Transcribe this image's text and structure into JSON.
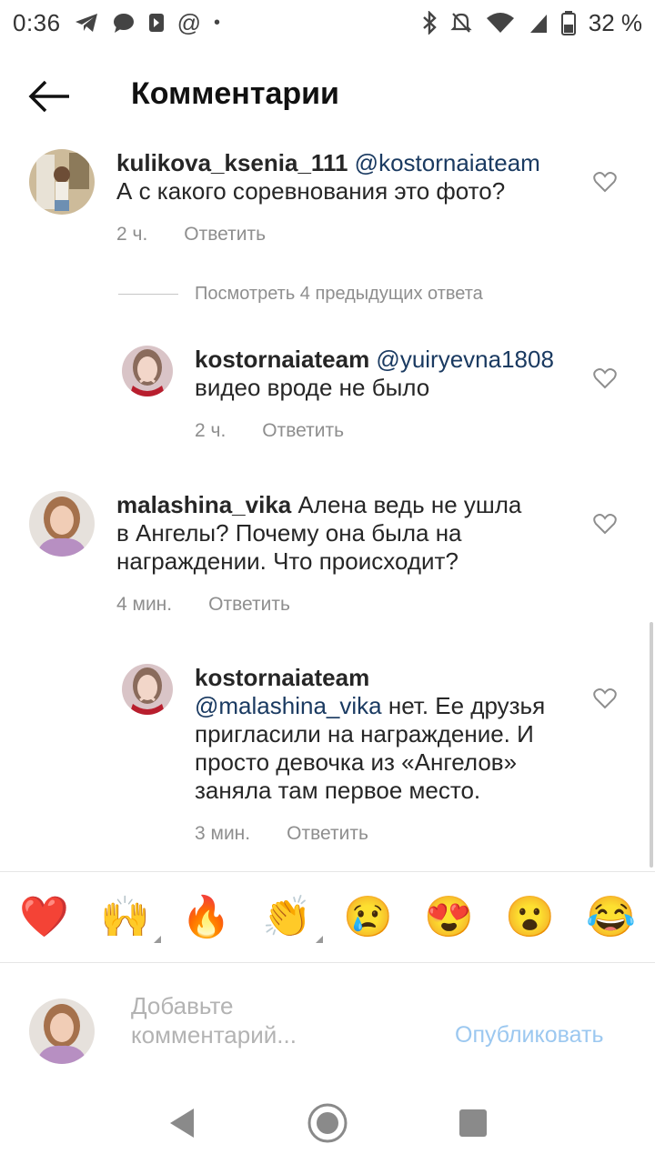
{
  "status_bar": {
    "time": "0:36",
    "battery": "32 %"
  },
  "header": {
    "title": "Комментарии"
  },
  "comments": [
    {
      "username": "kulikova_ksenia_111",
      "mention": "@kostornaiateam",
      "text": "А с какого соревнования это фото?",
      "time": "2 ч.",
      "reply": "Ответить"
    },
    {
      "username": "kostornaiateam",
      "mention": "@yuiryevna1808",
      "text": "видео вроде не было",
      "time": "2 ч.",
      "reply": "Ответить"
    },
    {
      "username": "malashina_vika",
      "mention": "",
      "text": "Алена ведь не ушла в Ангелы? Почему она была на награждении. Что происходит?",
      "time": "4 мин.",
      "reply": "Ответить"
    },
    {
      "username": "kostornaiateam",
      "mention": "@malashina_vika",
      "text": "нет. Ее друзья пригласили на награждение. И просто девочка из «Ангелов» заняла там первое место.",
      "time": "3 мин.",
      "reply": "Ответить"
    }
  ],
  "view_previous": "Посмотреть 4 предыдущих ответа",
  "emojis": [
    "❤️",
    "🙌",
    "🔥",
    "👏",
    "😢",
    "😍",
    "😮",
    "😂"
  ],
  "composer": {
    "placeholder": "Добавьте комментарий...",
    "publish": "Опубликовать"
  }
}
